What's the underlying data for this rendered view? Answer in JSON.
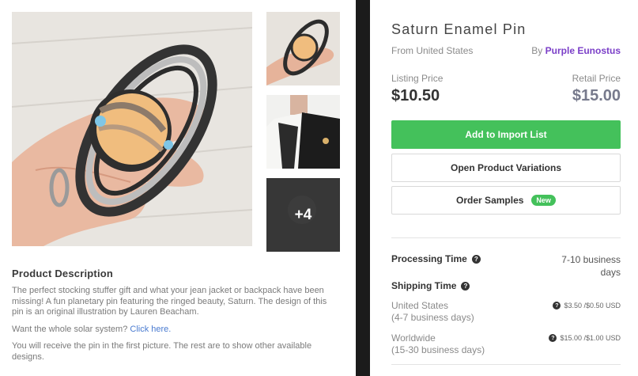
{
  "gallery": {
    "more_count": "+4"
  },
  "description": {
    "title": "Product Description",
    "paragraph1": "The perfect stocking stuffer gift and what your jean jacket or backpack have been missing! A fun planetary pin featuring the ringed beauty, Saturn. The design of this pin is an original illustration by Lauren Beacham.",
    "paragraph2_prefix": "Want the whole solar system?",
    "paragraph2_link": "Click here.",
    "paragraph3": "You will receive the pin in the first picture. The rest are to show other available designs."
  },
  "product": {
    "title": "Saturn Enamel Pin",
    "origin": "From United States",
    "by_prefix": "By",
    "vendor": "Purple Eunostus",
    "listing_price_label": "Listing Price",
    "listing_price": "$10.50",
    "retail_price_label": "Retail Price",
    "retail_price": "$15.00"
  },
  "actions": {
    "add_to_import": "Add to Import List",
    "open_variations": "Open Product Variations",
    "order_samples": "Order Samples",
    "new_badge": "New"
  },
  "processing": {
    "label": "Processing Time",
    "value": "7-10 business days"
  },
  "shipping": {
    "label": "Shipping Time",
    "rows": [
      {
        "dest": "United States",
        "time": "(4-7 business days)",
        "price": "$3.50 /$0.50 USD"
      },
      {
        "dest": "Worldwide",
        "time": "(15-30 business days)",
        "price": "$15.00 /$1.00 USD"
      }
    ]
  },
  "icons": {
    "help": "question-circle-icon"
  },
  "colors": {
    "accent_green": "#44c15b",
    "vendor_purple": "#7b3fc8",
    "retail_price": "#777a8c",
    "link_blue": "#4a7bd0"
  }
}
